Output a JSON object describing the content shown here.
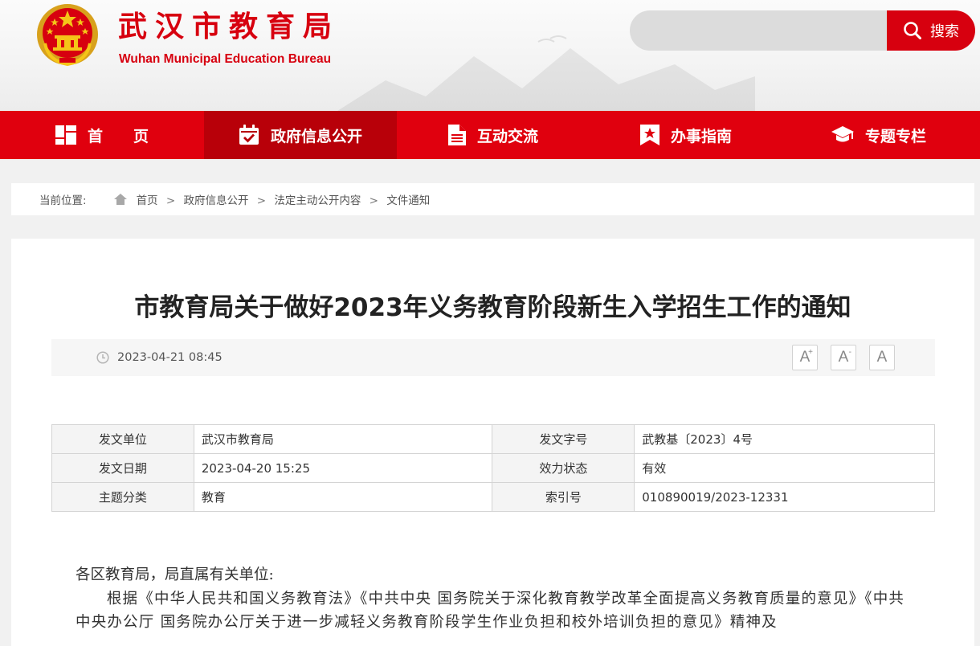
{
  "header": {
    "title_cn": "武汉市教育局",
    "title_en": "Wuhan Municipal Education Bureau",
    "search": {
      "placeholder": "",
      "button_label": "搜索"
    }
  },
  "nav": {
    "items": [
      {
        "label": "首页",
        "icon": "dashboard-icon",
        "active": false
      },
      {
        "label": "政府信息公开",
        "icon": "calendar-check-icon",
        "active": true
      },
      {
        "label": "互动交流",
        "icon": "document-icon",
        "active": false
      },
      {
        "label": "办事指南",
        "icon": "bookmark-star-icon",
        "active": false
      },
      {
        "label": "专题专栏",
        "icon": "graduation-cap-icon",
        "active": false
      }
    ]
  },
  "breadcrumb": {
    "label": "当前位置:",
    "items": [
      "首页",
      "政府信息公开",
      "法定主动公开内容",
      "文件通知"
    ],
    "separator": ">"
  },
  "article": {
    "title": "市教育局关于做好2023年义务教育阶段新生入学招生工作的通知",
    "date": "2023-04-21 08:45",
    "font_buttons": [
      "A+",
      "A-",
      "A"
    ],
    "info": {
      "issuer_label": "发文单位",
      "issuer": "武汉市教育局",
      "doc_no_label": "发文字号",
      "doc_no": "武教基〔2023〕4号",
      "issue_date_label": "发文日期",
      "issue_date": "2023-04-20 15:25",
      "status_label": "效力状态",
      "status": "有效",
      "category_label": "主题分类",
      "category": "教育",
      "index_label": "索引号",
      "index_no": "010890019/2023-12331"
    },
    "salutation": "各区教育局，局直属有关单位:",
    "paragraph_1": "根据《中华人民共和国义务教育法》《中共中央 国务院关于深化教育教学改革全面提高义务教育质量的意见》《中共中央办公厅 国务院办公厅关于进一步减轻义务教育阶段学生作业负担和校外培训负担的意见》精神及"
  },
  "colors": {
    "brand_red": "#d7000f",
    "nav_red": "#e0000e",
    "nav_active": "#b80009"
  }
}
